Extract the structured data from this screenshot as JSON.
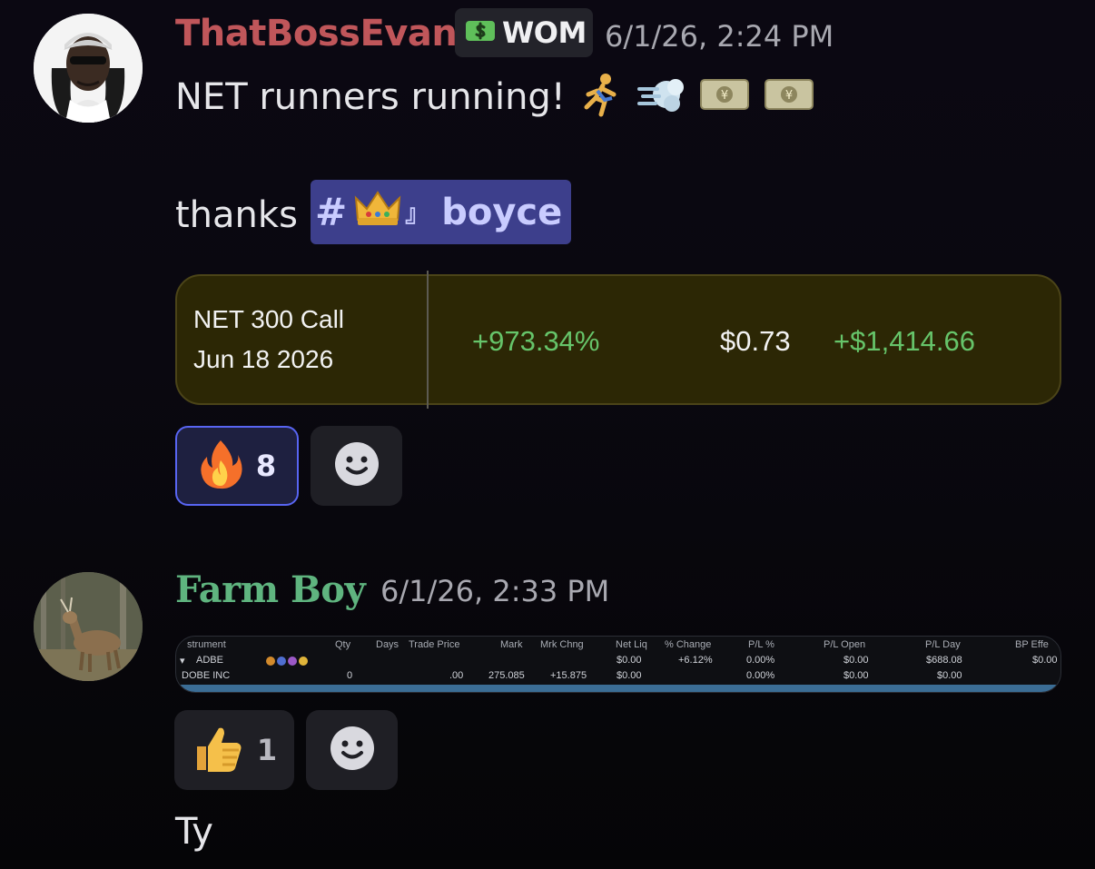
{
  "messages": [
    {
      "author": "ThatBossEvan",
      "author_color": "#c0565a",
      "role_tag": "WOM",
      "timestamp": "6/1/26, 2:24 PM",
      "line1": "NET runners running!",
      "line1_emojis": [
        "🏃",
        "💨",
        "💴",
        "💴"
      ],
      "line2_prefix": "thanks",
      "mention": "boyce",
      "mention_emojis": [
        "👑",
        "』"
      ],
      "trade_card": {
        "title_line1": "NET 300 Call",
        "title_line2": "Jun 18 2026",
        "percent": "+973.34%",
        "mark": "$0.73",
        "pl": "+$1,414.66"
      },
      "reactions": [
        {
          "emoji": "🔥",
          "count": "8",
          "selected": true
        },
        {
          "emoji": "add-reaction-icon",
          "count": ""
        }
      ]
    },
    {
      "author": "Farm Boy",
      "author_color": "#5fb47f",
      "timestamp": "6/1/26, 2:33 PM",
      "attachment_table": {
        "headers": [
          "strument",
          "Qty",
          "Days",
          "Trade Price",
          "Mark",
          "Mrk Chng",
          "Net Liq",
          "% Change",
          "P/L %",
          "P/L Open",
          "P/L Day",
          "BP Effe"
        ],
        "rows": [
          [
            "ADBE",
            "",
            "",
            "",
            "",
            "",
            "$0.00",
            "+6.12%",
            "0.00%",
            "$0.00",
            "$688.08",
            "$0.00"
          ],
          [
            "DOBE INC",
            "0",
            "",
            ".00",
            "275.085",
            "+15.875",
            "$0.00",
            "",
            "0.00%",
            "$0.00",
            "$0.00",
            ""
          ]
        ]
      },
      "reactions": [
        {
          "emoji": "👍",
          "count": "1"
        },
        {
          "emoji": "add-reaction-icon",
          "count": ""
        }
      ]
    },
    {
      "text": "Ty"
    }
  ]
}
